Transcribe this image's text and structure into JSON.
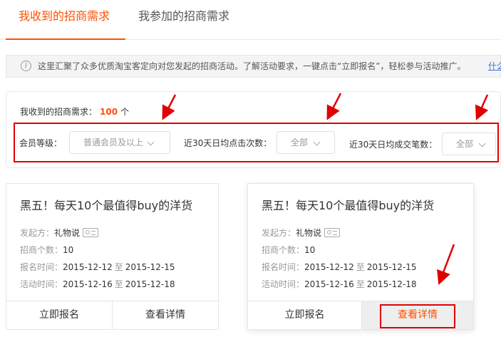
{
  "tabs": [
    {
      "label": "我收到的招商需求",
      "active": true
    },
    {
      "label": "我参加的招商需求",
      "active": false
    }
  ],
  "notice": {
    "icon": "info-icon",
    "text": "这里汇聚了众多优质淘宝客定向对您发起的招商活动。了解活动要求，一键点击“立即报名”，轻松参与活动推广。",
    "link": "什么"
  },
  "filters": {
    "count_label": "我收到的招商需求：",
    "count_value": "100",
    "count_unit": "个",
    "member_level": {
      "label": "会员等级：",
      "value": "普通会员及以上"
    },
    "clicks": {
      "label": "近30天日均点击次数：",
      "value": "全部"
    },
    "deals": {
      "label": "近30天日均成交笔数：",
      "value": "全部"
    }
  },
  "cards": [
    {
      "title": "黑五！每天10个最值得buy的洋货",
      "initiator_label": "发起方：",
      "initiator": "礼物说",
      "quota_label": "招商个数：",
      "quota": "10",
      "signup_label": "报名时间：",
      "signup_start": "2015-12-12",
      "signup_end": "2015-12-15",
      "activity_label": "活动时间：",
      "activity_start": "2015-12-16",
      "activity_end": "2015-12-18",
      "range_sep": "至",
      "signup_button": "立即报名",
      "detail_button": "查看详情"
    },
    {
      "title": "黑五！每天10个最值得buy的洋货",
      "initiator_label": "发起方：",
      "initiator": "礼物说",
      "quota_label": "招商个数：",
      "quota": "10",
      "signup_label": "报名时间：",
      "signup_start": "2015-12-12",
      "signup_end": "2015-12-15",
      "activity_label": "活动时间：",
      "activity_start": "2015-12-16",
      "activity_end": "2015-12-18",
      "range_sep": "至",
      "signup_button": "立即报名",
      "detail_button": "查看详情"
    }
  ],
  "colors": {
    "accent": "#ff5000",
    "annotation_red": "#e10000",
    "link": "#3c73d8"
  }
}
